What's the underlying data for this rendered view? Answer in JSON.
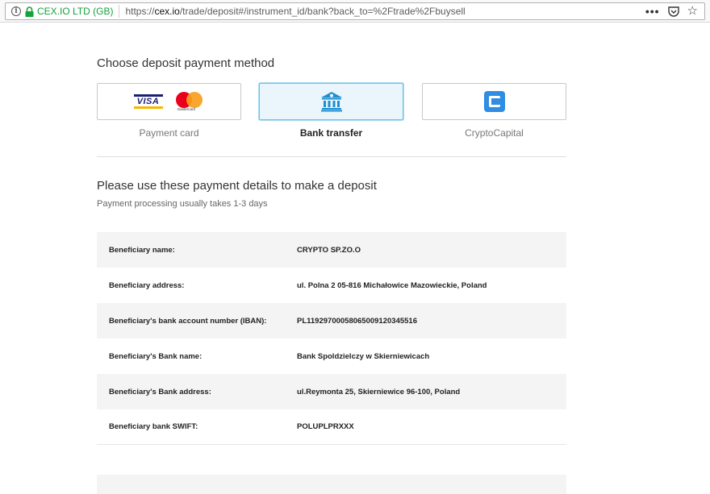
{
  "browser": {
    "site_identity": "CEX.IO LTD (GB)",
    "url_prefix": "https://",
    "url_host": "cex.io",
    "url_path": "/trade/deposit#/instrument_id/bank?back_to=%2Ftrade%2Fbuysell",
    "icons": [
      "info-icon",
      "lock-icon",
      "more-dots-icon",
      "pocket-icon",
      "bookmark-star-icon"
    ]
  },
  "deposit": {
    "heading": "Choose deposit payment method",
    "methods": [
      {
        "label": "Payment card",
        "icon": "visa-mastercard-icon",
        "selected": false
      },
      {
        "label": "Bank transfer",
        "icon": "bank-icon",
        "selected": true
      },
      {
        "label": "CryptoCapital",
        "icon": "cryptocapital-icon",
        "selected": false
      }
    ],
    "visa_text": "VISA",
    "mastercard_text": "mastercard"
  },
  "details": {
    "heading": "Please use these payment details to make a deposit",
    "subheading": "Payment processing usually takes 1-3 days",
    "rows": [
      {
        "label": "Beneficiary name:",
        "value": "CRYPTO SP.ZO.O"
      },
      {
        "label": "Beneficiary address:",
        "value": "ul. Polna 2 05-816 Michałowice Mazowieckie, Poland"
      },
      {
        "label": "Beneficiary's bank account number (IBAN):",
        "value": "PL11929700058065009120345516"
      },
      {
        "label": "Beneficiary's Bank name:",
        "value": "Bank Spoldzielczy w Skierniewicach"
      },
      {
        "label": "Beneficiary's Bank address:",
        "value": "ul.Reymonta 25, Skierniewice 96-100, Poland"
      },
      {
        "label": "Beneficiary bank SWIFT:",
        "value": "POLUPLPRXXX"
      }
    ]
  },
  "colors": {
    "accent": "#6fc2e6",
    "selected_bg": "#eaf6fc",
    "secure_green": "#12a33a",
    "bank_icon": "#1b8fd2",
    "cryptocapital_icon": "#2f8de4"
  }
}
